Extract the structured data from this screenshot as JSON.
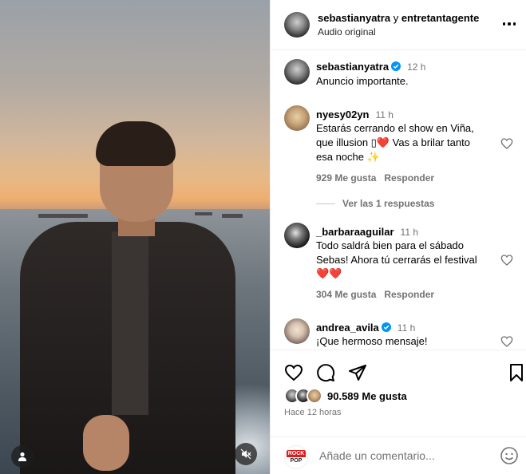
{
  "header": {
    "author": "sebastianyatra",
    "connector": "y",
    "collaborator": "entretantagente",
    "subtitle": "Audio original"
  },
  "caption": {
    "username": "sebastianyatra",
    "time": "12 h",
    "text": "Anuncio importante."
  },
  "comments": [
    {
      "username": "nyesy02yn",
      "time": "11 h",
      "line1": "Estarás cerrando el show en Viña,",
      "line2": "que illusion ▯❤️  Vas a brilar tanto",
      "line3": "esa noche ✨",
      "likes": "929 Me gusta",
      "reply": "Responder",
      "view_replies": "Ver las 1 respuestas"
    },
    {
      "username": "_barbaraaguilar",
      "time": "11 h",
      "line1": "Todo saldrá bien para el sábado",
      "line2": "Sebas! Ahora tú cerrarás el festival",
      "line3": "❤️❤️",
      "likes": "304 Me gusta",
      "reply": "Responder"
    },
    {
      "username": "andrea_avila",
      "time": "11 h",
      "line1": "¡Que hermoso mensaje!"
    }
  ],
  "actions": {
    "likes_count": "90.589 Me gusta",
    "time_ago": "Hace 12 horas"
  },
  "add_comment": {
    "placeholder": "Añade un comentario...",
    "avatar_top": "ROCK",
    "avatar_bottom": "POP"
  },
  "colors": {
    "secondary_text": "#737373",
    "verified_blue": "#0095f6",
    "divider": "#efefef"
  }
}
